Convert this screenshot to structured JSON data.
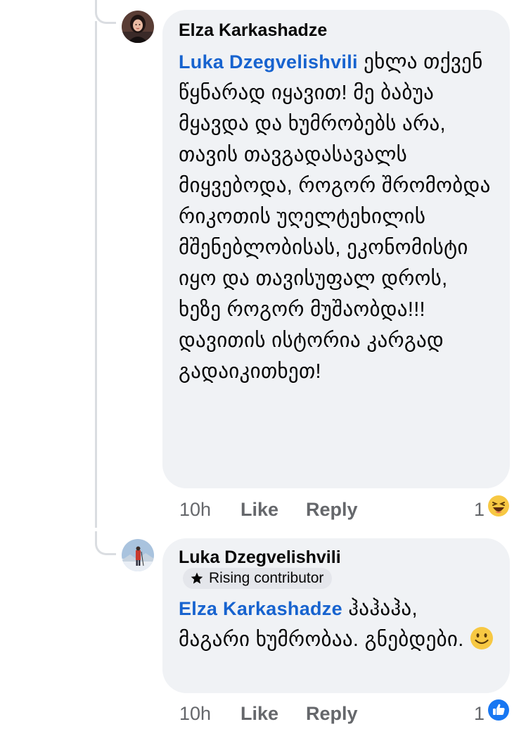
{
  "comments": [
    {
      "author": "Elza Karkashadze",
      "avatar_icon": "profile-photo-woman",
      "mention": "Luka Dzegvelishvili",
      "text": "ეხლა თქვენ წყნარად იყავით! მე ბაბუა მყავდა და ხუმრობებს არა, თავის თავგადასავალს მიყვებოდა, როგორ შრომობდა რიკოთის უღელტეხილის მშენებლობისას, ეკონომისტი იყო და თავისუფალ დროს, ხეზე როგორ მუშაობდა!!! დავითის ისტორია კარგად გადაიკითხეთ!",
      "time": "10h",
      "like_label": "Like",
      "reply_label": "Reply",
      "reaction_count": "1",
      "reaction_icon": "laughing-emoji-icon"
    },
    {
      "author": "Luka Dzegvelishvili",
      "avatar_icon": "profile-photo-man-snow",
      "badge": "Rising contributor",
      "badge_icon": "star-icon",
      "mention": "Elza Karkashadze",
      "text": "ჰაჰაჰა, მაგარი ხუმრობაა. გნებდები.",
      "text_emoji": "smiling-emoji-icon",
      "time": "10h",
      "like_label": "Like",
      "reply_label": "Reply",
      "reaction_count": "1",
      "reaction_icon": "like-thumb-icon"
    }
  ],
  "colors": {
    "bubble": "#f0f2f5",
    "mention": "#1763cf",
    "meta": "#65676b",
    "like_blue": "#1877f2"
  }
}
